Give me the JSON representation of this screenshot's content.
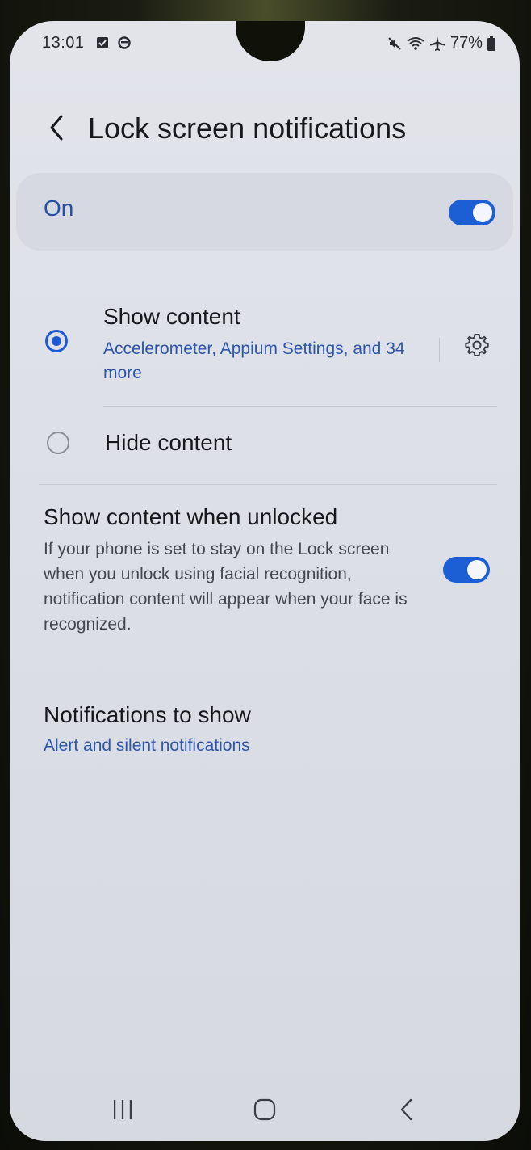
{
  "status_bar": {
    "time": "13:01",
    "battery": "77%",
    "left_icons": [
      "checkbox-notification-icon",
      "circle-notification-icon"
    ],
    "right_icons": [
      "mute-icon",
      "wifi-icon",
      "airplane-icon",
      "battery-icon"
    ]
  },
  "header": {
    "back_icon": "chevron-left-icon",
    "title": "Lock screen notifications"
  },
  "master_switch": {
    "label": "On",
    "checked": true
  },
  "content_options": [
    {
      "title": "Show content",
      "subtitle": "Accelerometer, Appium Settings, and 34 more",
      "selected": true,
      "settings_icon": "gear-icon"
    },
    {
      "title": "Hide content",
      "selected": false
    }
  ],
  "show_when_unlocked": {
    "title": "Show content when unlocked",
    "description": "If your phone is set to stay on the Lock screen when you unlock using facial recognition, notification content will appear when your face is recognized.",
    "checked": true
  },
  "notifications_to_show": {
    "title": "Notifications to show",
    "value": "Alert and silent notifications"
  },
  "nav_bar": {
    "icons": [
      "recent-apps-icon",
      "home-icon",
      "back-icon"
    ]
  },
  "colors": {
    "accent": "#1c5fd4",
    "link_text": "#2c56a8",
    "background": "#dcdfe6"
  }
}
